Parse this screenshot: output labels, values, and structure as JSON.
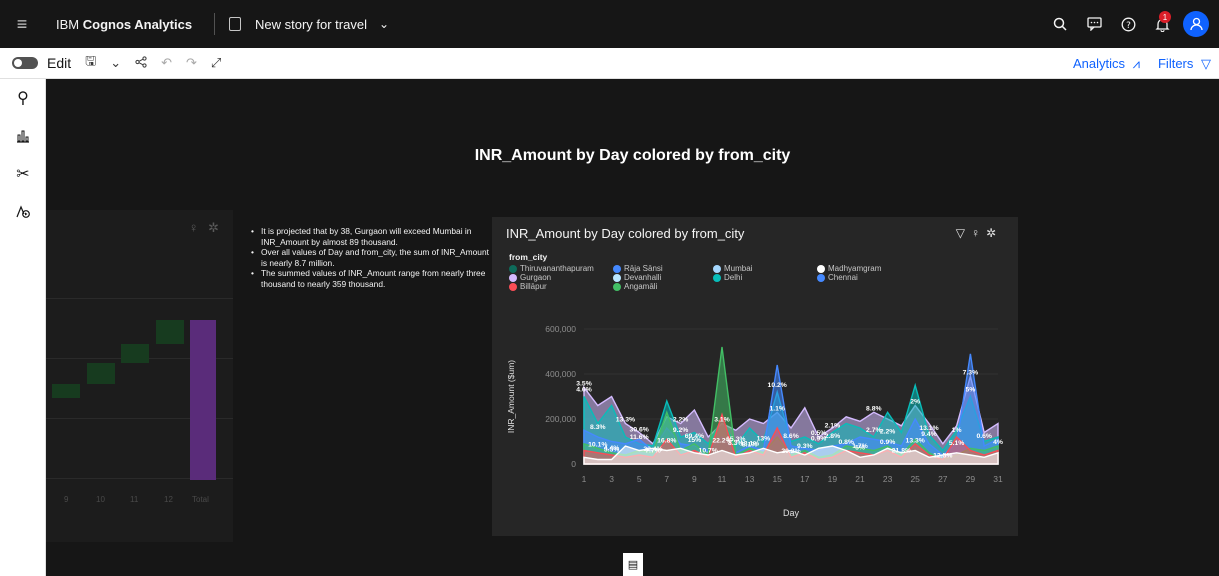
{
  "app": {
    "brand_prefix": "IBM ",
    "brand_name": "Cognos Analytics",
    "story_title": "New story for travel",
    "notification_count": "1"
  },
  "toolbar": {
    "edit_label": "Edit",
    "analytics_label": "Analytics",
    "filters_label": "Filters"
  },
  "story": {
    "heading": "INR_Amount by Day colored by from_city"
  },
  "left_card": {
    "x_labels": [
      "9",
      "10",
      "11",
      "12",
      "Total"
    ]
  },
  "insights": [
    "It is projected that by 38, Gurgaon will exceed Mumbai in INR_Amount by almost 89 thousand.",
    "Over all values of Day and from_city, the sum of INR_Amount is nearly 8.7 million.",
    "The summed values of INR_Amount range from nearly three thousand to nearly 359 thousand."
  ],
  "colors": {
    "accent": "#0f62fe",
    "canvas": "#161616",
    "card": "#262626",
    "notification": "#da1e28"
  },
  "chart_data": {
    "type": "area",
    "title": "INR_Amount by Day colored by from_city",
    "xlabel": "Day",
    "ylabel": "INR_Amount ($um)",
    "ylim": [
      0,
      600000
    ],
    "y_ticks": [
      "0",
      "200,000",
      "400,000",
      "600,000"
    ],
    "x_ticks": [
      "1",
      "3",
      "5",
      "7",
      "9",
      "11",
      "13",
      "15",
      "17",
      "19",
      "21",
      "23",
      "25",
      "27",
      "29",
      "31"
    ],
    "legend_title": "from_city",
    "legend": [
      {
        "name": "Thiruvananthapuram",
        "color": "#0e6b5a"
      },
      {
        "name": "Rāja Sānsi",
        "color": "#4589ff"
      },
      {
        "name": "Mumbai",
        "color": "#a6d8ff"
      },
      {
        "name": "Madhyamgram",
        "color": "#ffffff"
      },
      {
        "name": "Gurgaon",
        "color": "#d4bbff"
      },
      {
        "name": "Devanhalli",
        "color": "#bae6ff"
      },
      {
        "name": "Delhi",
        "color": "#08bdba"
      },
      {
        "name": "Chennai",
        "color": "#4589ff"
      },
      {
        "name": "Billāpur",
        "color": "#fa4d56"
      },
      {
        "name": "Angamāli",
        "color": "#42be65"
      }
    ],
    "x": [
      1,
      2,
      3,
      4,
      5,
      6,
      7,
      8,
      9,
      10,
      11,
      12,
      13,
      14,
      15,
      16,
      17,
      18,
      19,
      20,
      21,
      22,
      23,
      24,
      25,
      26,
      27,
      28,
      29,
      30,
      31
    ],
    "series": [
      {
        "name": "Gurgaon",
        "color": "#d4bbff",
        "values": [
          340000,
          260000,
          300000,
          180000,
          140000,
          90000,
          210000,
          180000,
          240000,
          120000,
          180000,
          150000,
          200000,
          180000,
          230000,
          160000,
          250000,
          120000,
          160000,
          210000,
          190000,
          230000,
          200000,
          170000,
          260000,
          180000,
          90000,
          170000,
          390000,
          140000,
          180000
        ]
      },
      {
        "name": "Delhi",
        "color": "#08bdba",
        "values": [
          300000,
          180000,
          260000,
          120000,
          90000,
          80000,
          280000,
          120000,
          140000,
          90000,
          200000,
          80000,
          160000,
          100000,
          320000,
          100000,
          120000,
          90000,
          140000,
          180000,
          160000,
          120000,
          230000,
          140000,
          350000,
          130000,
          60000,
          150000,
          300000,
          100000,
          120000
        ]
      },
      {
        "name": "Chennai",
        "color": "#4589ff",
        "values": [
          150000,
          120000,
          100000,
          90000,
          110000,
          60000,
          160000,
          90000,
          80000,
          60000,
          120000,
          50000,
          80000,
          60000,
          440000,
          80000,
          70000,
          60000,
          80000,
          90000,
          120000,
          110000,
          100000,
          80000,
          200000,
          90000,
          40000,
          90000,
          490000,
          80000,
          110000
        ]
      },
      {
        "name": "Angamāli",
        "color": "#42be65",
        "values": [
          90000,
          70000,
          50000,
          40000,
          60000,
          50000,
          230000,
          60000,
          90000,
          40000,
          520000,
          40000,
          70000,
          50000,
          120000,
          40000,
          60000,
          30000,
          40000,
          80000,
          70000,
          60000,
          80000,
          40000,
          110000,
          50000,
          20000,
          40000,
          70000,
          60000,
          80000
        ]
      },
      {
        "name": "Billāpur",
        "color": "#fa4d56",
        "values": [
          60000,
          50000,
          40000,
          30000,
          40000,
          30000,
          110000,
          40000,
          60000,
          30000,
          220000,
          30000,
          60000,
          40000,
          160000,
          30000,
          50000,
          20000,
          30000,
          60000,
          50000,
          40000,
          60000,
          30000,
          90000,
          40000,
          20000,
          120000,
          60000,
          40000,
          60000
        ]
      },
      {
        "name": "Madhyamgram",
        "color": "#ffffff",
        "values": [
          30000,
          20000,
          20000,
          80000,
          60000,
          70000,
          60000,
          70000,
          50000,
          40000,
          60000,
          40000,
          50000,
          70000,
          50000,
          60000,
          40000,
          70000,
          80000,
          60000,
          30000,
          40000,
          70000,
          50000,
          60000,
          30000,
          40000,
          50000,
          40000,
          30000,
          50000
        ]
      }
    ],
    "data_labels": [
      "3.5%",
      "4.6%",
      "8.3%",
      "10.1%",
      "4.4%",
      "5.5%",
      "13.3%",
      "11.6%",
      "30.6%",
      "32.4%",
      "7.7%",
      "16.8%",
      "2.2%",
      "9.2%",
      "69.4%",
      "15%",
      "10.7%",
      "22.2%",
      "3.1%",
      "15.3%",
      "8.3%",
      "8.1%",
      "13.1%",
      "13%",
      "1.1%",
      "10.2%",
      "8.6%",
      "20.2%",
      "9.3%",
      "0.9%",
      "0.5%",
      "2.1%",
      "2.8%",
      "0.8%",
      "1.7%",
      "5%",
      "8.8%",
      "2.7%",
      "2.2%",
      "0.9%",
      "21.8%",
      "13.3%",
      "2%",
      "13.1%",
      "9.4%",
      "12.5%",
      "1%",
      "5.1%",
      "7.3%",
      "5%",
      "0.6%",
      "4%"
    ]
  }
}
